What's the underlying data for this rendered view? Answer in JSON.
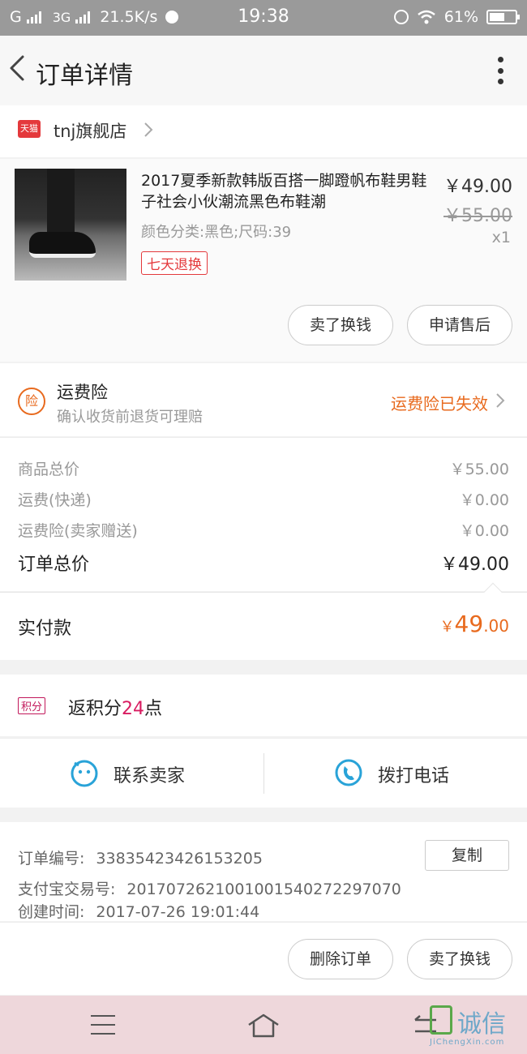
{
  "status_bar": {
    "carrier1": "G",
    "carrier2": "3G",
    "speed": "21.5K/s",
    "time": "19:38",
    "battery": "61%",
    "battery_level": 0.61
  },
  "header": {
    "title": "订单详情"
  },
  "shop": {
    "badge": "天猫",
    "name": "tnj旗舰店"
  },
  "item": {
    "name": "2017夏季新款韩版百搭一脚蹬帆布鞋男鞋子社会小伙潮流黑色布鞋潮",
    "spec": "颜色分类:黑色;尺码:39",
    "tag": "七天退换",
    "price": "￥49.00",
    "original_price": "￥55.00",
    "quantity": "x1",
    "btn_sell": "卖了换钱",
    "btn_aftersale": "申请售后"
  },
  "insurance": {
    "icon_text": "险",
    "title": "运费险",
    "subtitle": "确认收货前退货可理赔",
    "status": "运费险已失效"
  },
  "costs": {
    "rows": [
      {
        "label": "商品总价",
        "value": "￥55.00"
      },
      {
        "label": "运费(快递)",
        "value": "￥0.00"
      },
      {
        "label": "运费险(卖家赠送)",
        "value": "￥0.00"
      }
    ],
    "total_label": "订单总价",
    "total_value": "￥49.00"
  },
  "paid": {
    "label": "实付款",
    "currency": "￥",
    "integer": "49",
    "decimal": ".00"
  },
  "points": {
    "badge": "积分",
    "prefix": "返积分",
    "number": "24",
    "suffix": "点"
  },
  "contact": {
    "seller": "联系卖家",
    "phone": "拨打电话"
  },
  "order_info": {
    "order_no_label": "订单编号:",
    "order_no": "33835423426153205",
    "copy": "复制",
    "alipay_label": "支付宝交易号:",
    "alipay_no": "2017072621001001540272297070",
    "created_label": "创建时间:",
    "created_time": "2017-07-26 19:01:44"
  },
  "actions": {
    "delete": "删除订单",
    "sell": "卖了换钱"
  },
  "watermark": {
    "cn": "诚信",
    "en": "JiChengXin.com"
  },
  "colors": {
    "accent_orange": "#e86a1e",
    "tmall_red": "#e4393c",
    "points_pink": "#d81b60",
    "icon_blue": "#29a3d8"
  }
}
